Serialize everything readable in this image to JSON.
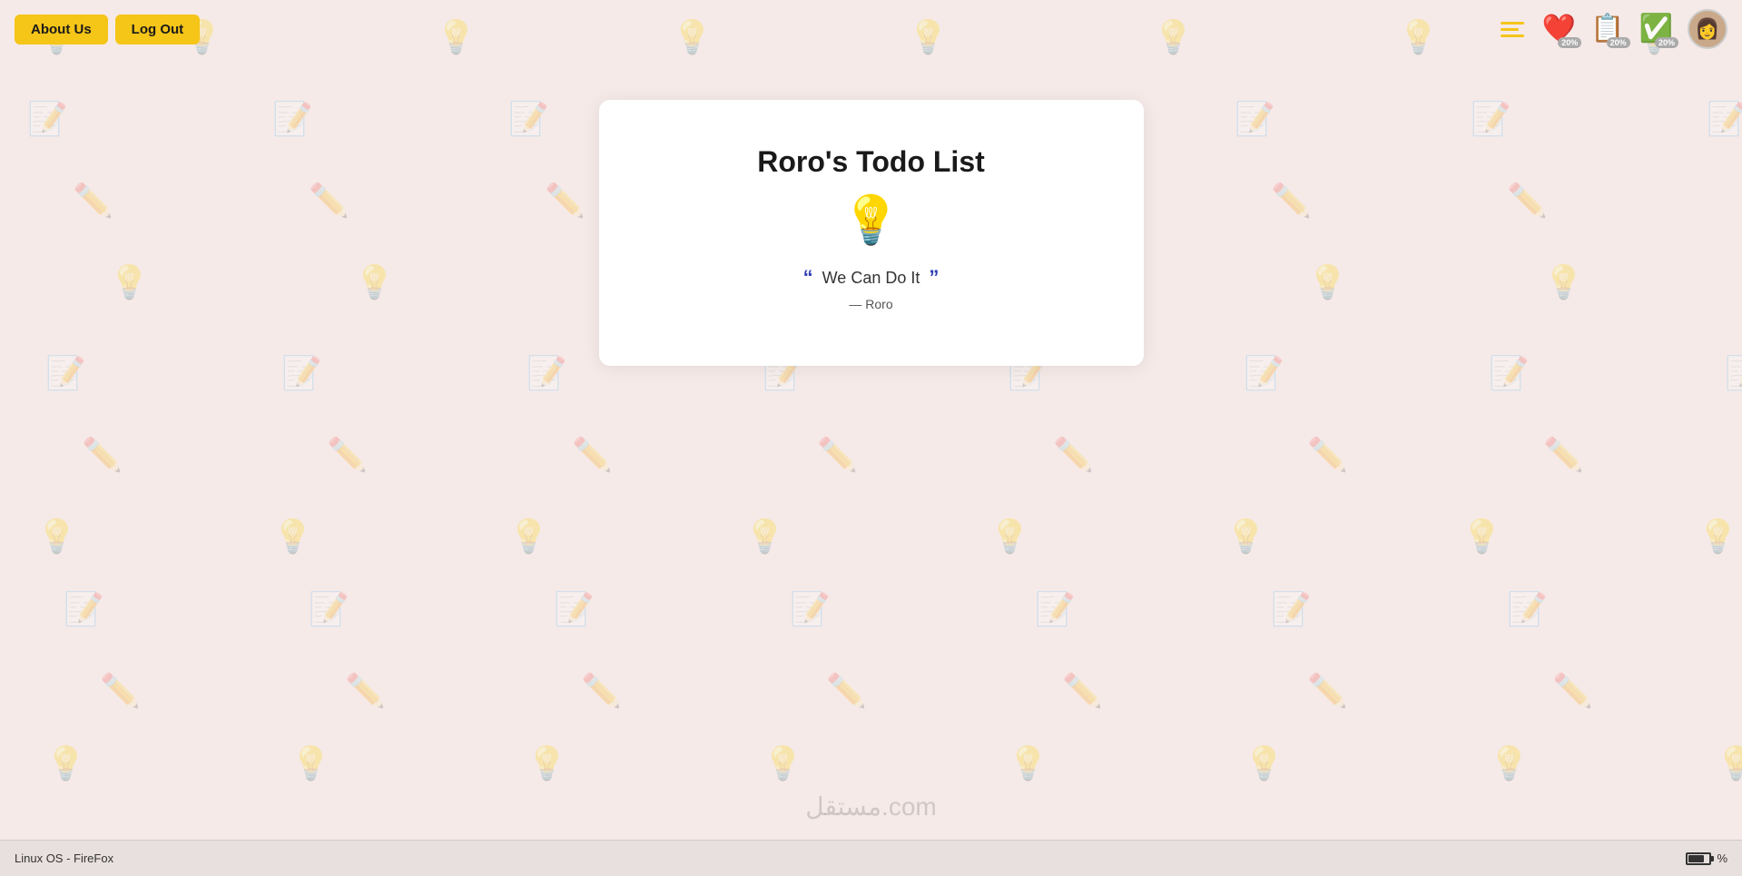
{
  "nav": {
    "about_label": "About Us",
    "logout_label": "Log Out"
  },
  "stats": {
    "heart": {
      "value": "20%",
      "icon": "❤️"
    },
    "list": {
      "value": "20%",
      "icon": "📋"
    },
    "check": {
      "value": "20%",
      "icon": "✅"
    }
  },
  "card": {
    "title": "Roro's Todo List",
    "bulb_emoji": "💡",
    "quote_text": "We Can Do It",
    "quote_author": "— Roro",
    "open_quote": "“",
    "close_quote": "”"
  },
  "watermark": {
    "text": "مستقل.com"
  },
  "taskbar": {
    "os_label": "Linux OS - FireFox",
    "percent_label": "%",
    "battery_fill": 70
  }
}
